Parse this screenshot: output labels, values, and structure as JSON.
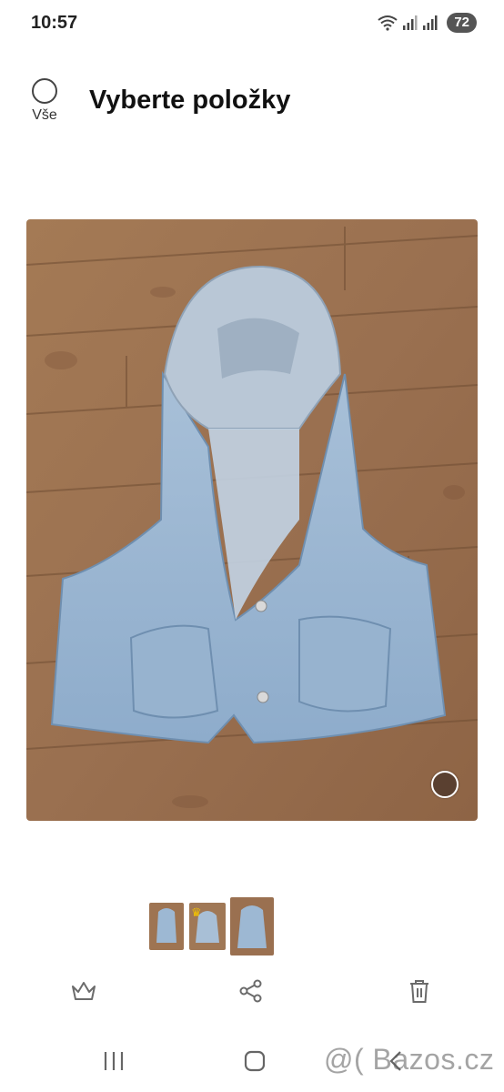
{
  "status_bar": {
    "time": "10:57",
    "battery": "72",
    "icons": [
      "wifi-icon",
      "signal-icon",
      "signal-icon",
      "battery-icon"
    ]
  },
  "header": {
    "select_all_label": "Vše",
    "title": "Vyberte položky"
  },
  "photo": {
    "description_icon": "photo-denim-vest",
    "selected": false
  },
  "thumbnails": [
    {
      "icon": "thumbnail-vest-front",
      "selected": false
    },
    {
      "icon": "thumbnail-vest-hood",
      "selected": false,
      "crown": "♛"
    },
    {
      "icon": "thumbnail-vest-back",
      "selected": true
    }
  ],
  "actions": [
    {
      "icon": "crown-icon"
    },
    {
      "icon": "share-icon"
    },
    {
      "icon": "trash-icon"
    }
  ],
  "nav": {
    "icons": [
      "recent-apps-icon",
      "home-icon",
      "back-icon"
    ]
  },
  "watermark": "@( Bazos.cz",
  "colors": {
    "accent_photo_select": "#5a4030",
    "crown": "#f2c200",
    "icon_gray": "#6b6b6b"
  }
}
